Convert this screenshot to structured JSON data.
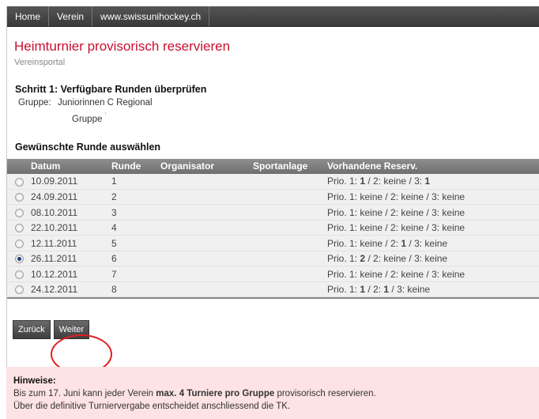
{
  "nav": {
    "items": [
      "Home",
      "Verein",
      "www.swissunihockey.ch"
    ]
  },
  "page": {
    "title": "Heimturnier provisorisch reservieren",
    "subtitle": "Vereinsportal"
  },
  "step": {
    "heading": "Schritt 1: Verfügbare Runden überprüfen",
    "group_label": "Gruppe:",
    "group_value": "Juniorinnen C Regional",
    "group_sub": "Gruppe",
    "group_sub_mark": "'"
  },
  "rounds": {
    "heading": "Gewünschte Runde auswählen",
    "columns": [
      "Datum",
      "Runde",
      "Organisator",
      "Sportanlage",
      "Vorhandene Reserv."
    ],
    "rows": [
      {
        "selected": false,
        "date": "10.09.2011",
        "round": "1",
        "organizer": "",
        "venue": "",
        "reserv": [
          "Prio. 1: ",
          "1",
          " / 2: keine / 3: ",
          "1"
        ]
      },
      {
        "selected": false,
        "date": "24.09.2011",
        "round": "2",
        "organizer": "",
        "venue": "",
        "reserv": [
          "Prio. 1: keine / 2: keine / 3: keine"
        ]
      },
      {
        "selected": false,
        "date": "08.10.2011",
        "round": "3",
        "organizer": "",
        "venue": "",
        "reserv": [
          "Prio. 1: keine / 2: keine / 3: keine"
        ]
      },
      {
        "selected": false,
        "date": "22.10.2011",
        "round": "4",
        "organizer": "",
        "venue": "",
        "reserv": [
          "Prio. 1: keine / 2: keine / 3: keine"
        ]
      },
      {
        "selected": false,
        "date": "12.11.2011",
        "round": "5",
        "organizer": "",
        "venue": "",
        "reserv": [
          "Prio. 1: keine / 2: ",
          "1",
          " / 3: keine"
        ]
      },
      {
        "selected": true,
        "date": "26.11.2011",
        "round": "6",
        "organizer": "",
        "venue": "",
        "reserv": [
          "Prio. 1: ",
          "2",
          " / 2: keine / 3: keine"
        ]
      },
      {
        "selected": false,
        "date": "10.12.2011",
        "round": "7",
        "organizer": "",
        "venue": "",
        "reserv": [
          "Prio. 1: keine / 2: keine / 3: keine"
        ]
      },
      {
        "selected": false,
        "date": "24.12.2011",
        "round": "8",
        "organizer": "",
        "venue": "",
        "reserv": [
          "Prio. 1: ",
          "1",
          " / 2: ",
          "1",
          " / 3: keine"
        ]
      }
    ]
  },
  "buttons": {
    "back": "Zurück",
    "next": "Weiter"
  },
  "notes": {
    "heading": "Hinweise:",
    "line1_pre": "Bis zum 17. Juni kann jeder Verein ",
    "line1_bold": "max. 4 Turniere pro Gruppe",
    "line1_post": " provisorisch reservieren.",
    "line2": "Über die definitive Turniervergabe entscheidet anschliessend die TK."
  },
  "colors": {
    "title": "#c8102e",
    "highlight": "#e0201e",
    "notes_bg": "#fde3e3"
  }
}
